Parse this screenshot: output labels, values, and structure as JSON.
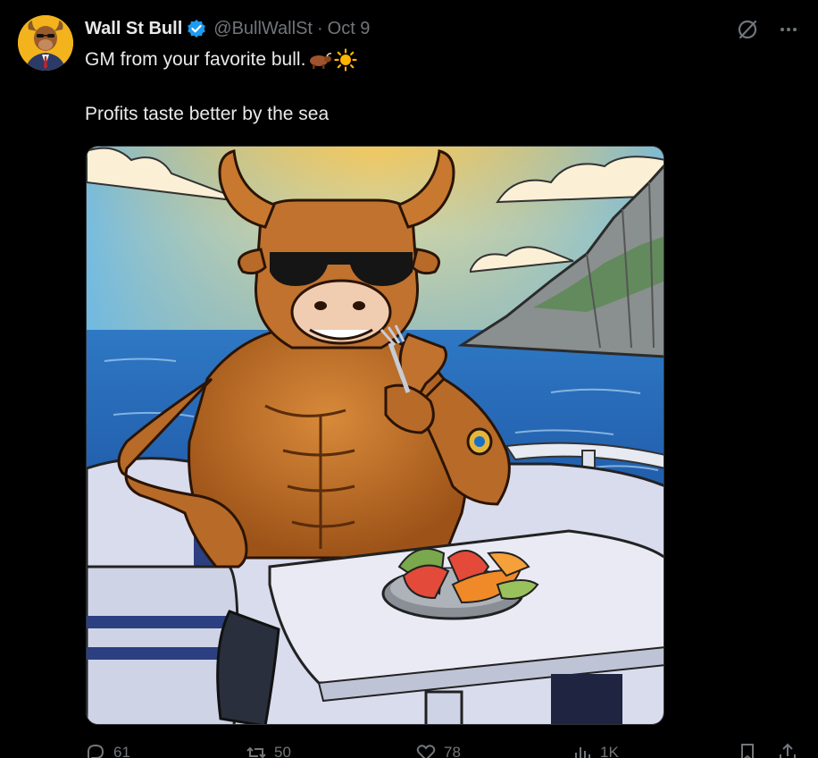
{
  "post": {
    "display_name": "Wall St Bull",
    "handle": "@BullWallSt",
    "separator": "·",
    "date": "Oct 9",
    "text_line1": "GM from your favorite bull.",
    "text_line2": "Profits taste better by the sea",
    "emojis": [
      "ox-emoji",
      "sun-emoji"
    ]
  },
  "actions": {
    "replies": "61",
    "reposts": "50",
    "likes": "78",
    "views": "1K"
  },
  "colors": {
    "background": "#000000",
    "text_primary": "#e7e9ea",
    "text_secondary": "#71767b",
    "verified_blue": "#1d9bf0",
    "avatar_bg": "#f2b31c"
  }
}
